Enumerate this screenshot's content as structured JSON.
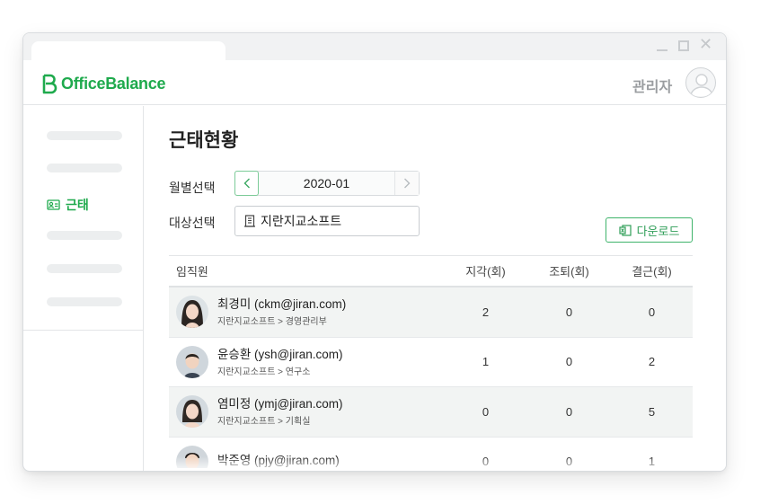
{
  "app": {
    "brand": "OfficeBalance",
    "brand_color": "#1faa4d"
  },
  "header": {
    "user_name": "관리자"
  },
  "sidebar": {
    "active_item": {
      "label": "근태",
      "icon": "attendance-card-icon"
    }
  },
  "page": {
    "title": "근태현황",
    "month_label": "월별선택",
    "month_value": "2020-01",
    "target_label": "대상선택",
    "target_value": "지란지교소프트",
    "download_label": "다운로드"
  },
  "table": {
    "headers": {
      "name": "임직원",
      "late": "지각(회)",
      "early": "조퇴(회)",
      "absent": "결근(회)"
    },
    "rows": [
      {
        "name": "최경미 (ckm@jiran.com)",
        "dept": "지란지교소프트 > 경영관리부",
        "late": "2",
        "early": "0",
        "absent": "0"
      },
      {
        "name": "윤승환 (ysh@jiran.com)",
        "dept": "지란지교소프트 > 연구소",
        "late": "1",
        "early": "0",
        "absent": "2"
      },
      {
        "name": "염미정 (ymj@jiran.com)",
        "dept": "지란지교소프트 > 기획실",
        "late": "0",
        "early": "0",
        "absent": "5"
      },
      {
        "name": "박준영 (pjy@jiran.com)",
        "dept": "",
        "late": "0",
        "early": "0",
        "absent": "1"
      }
    ]
  }
}
